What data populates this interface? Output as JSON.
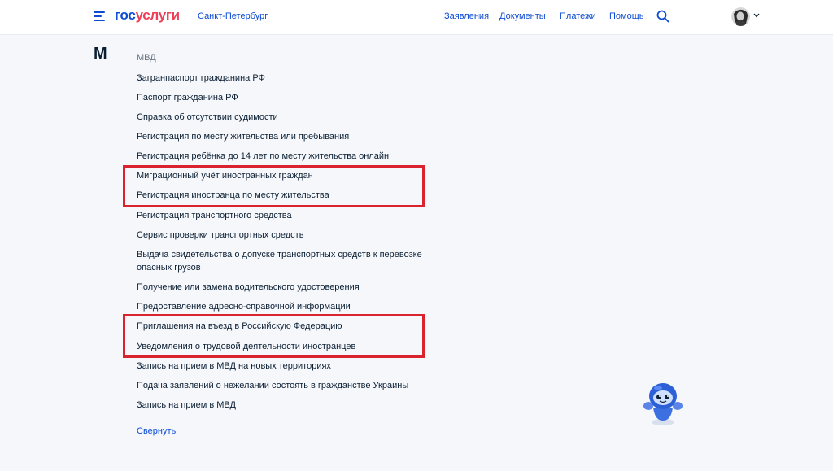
{
  "header": {
    "logo_part1": "гос",
    "logo_part2": "услуги",
    "region": "Санкт-Петербург",
    "nav": [
      "Заявления",
      "Документы",
      "Платежи",
      "Помощь"
    ]
  },
  "section": {
    "letter": "М",
    "department": "МВД",
    "items": [
      "Загранпаспорт гражданина РФ",
      "Паспорт гражданина РФ",
      "Справка об отсутствии судимости",
      "Регистрация по месту жительства или пребывания",
      "Регистрация ребёнка до 14 лет по месту жительства онлайн",
      "Миграционный учёт иностранных граждан",
      "Регистрация иностранца по месту жительства",
      "Регистрация транспортного средства",
      "Сервис проверки транспортных средств",
      "Выдача свидетельства о допуске транспортных средств к перевозке опасных грузов",
      "Получение или замена водительского удостоверения",
      "Предоставление адресно-справочной информации",
      "Приглашения на въезд в Российскую Федерацию",
      "Уведомления о трудовой деятельности иностранцев",
      "Запись на прием в МВД на новых территориях",
      "Подача заявлений о нежелании состоять в гражданстве Украины",
      "Запись на прием в МВД"
    ],
    "collapse_label": "Свернуть"
  },
  "colors": {
    "brand_blue": "#0d4cd3",
    "brand_red": "#ee3f58",
    "highlight_red": "#d9232e",
    "background": "#f5f7fb"
  },
  "icons": [
    "menu-icon",
    "search-icon",
    "chevron-down-icon",
    "avatar",
    "robot-assistant-icon"
  ]
}
